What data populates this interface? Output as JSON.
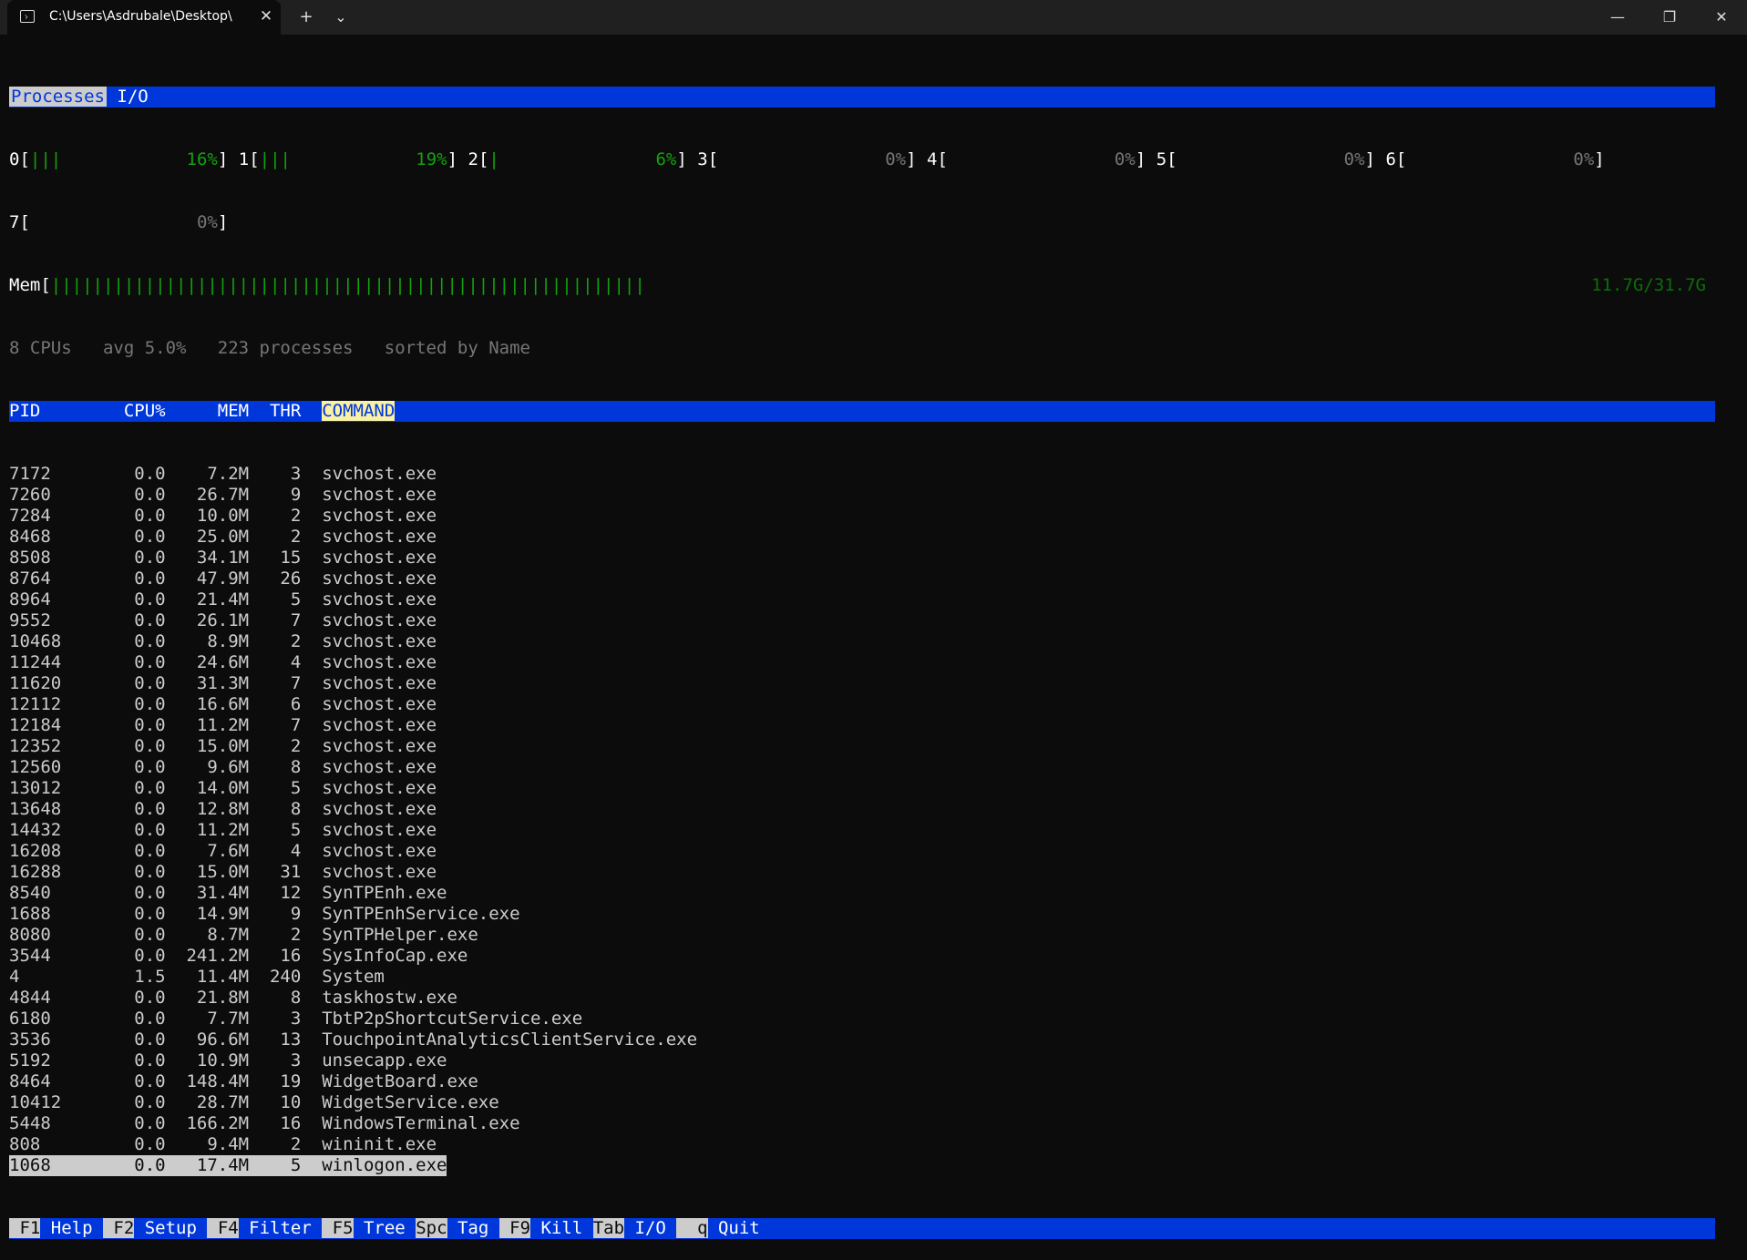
{
  "window": {
    "tab_title": "C:\\Users\\Asdrubale\\Desktop\\",
    "new_tab": "+",
    "dropdown": "⌄",
    "minimize": "—",
    "maximize": "❐",
    "close": "✕"
  },
  "tabs": [
    {
      "label": "Processes",
      "active": true
    },
    {
      "label": "I/O",
      "active": false
    }
  ],
  "cpus": [
    {
      "id": "0",
      "bars": "|||",
      "pct": "16%"
    },
    {
      "id": "1",
      "bars": "|||",
      "pct": "19%"
    },
    {
      "id": "2",
      "bars": "|",
      "pct": "6%"
    },
    {
      "id": "3",
      "bars": "",
      "pct": "0%"
    },
    {
      "id": "4",
      "bars": "",
      "pct": "0%"
    },
    {
      "id": "5",
      "bars": "",
      "pct": "0%"
    },
    {
      "id": "6",
      "bars": "",
      "pct": "0%"
    },
    {
      "id": "7",
      "bars": "",
      "pct": "0%"
    }
  ],
  "mem": {
    "label": "Mem",
    "bars": "|||||||||||||||||||||||||||||||||||||||||||||||||||||||||",
    "value": "11.7G/31.7G"
  },
  "summary": "8 CPUs   avg 5.0%   223 processes   sorted by Name",
  "columns": [
    "PID",
    "CPU%",
    "MEM",
    "THR",
    "COMMAND"
  ],
  "processes": [
    [
      "7172",
      "0.0",
      "7.2M",
      "3",
      "svchost.exe"
    ],
    [
      "7260",
      "0.0",
      "26.7M",
      "9",
      "svchost.exe"
    ],
    [
      "7284",
      "0.0",
      "10.0M",
      "2",
      "svchost.exe"
    ],
    [
      "8468",
      "0.0",
      "25.0M",
      "2",
      "svchost.exe"
    ],
    [
      "8508",
      "0.0",
      "34.1M",
      "15",
      "svchost.exe"
    ],
    [
      "8764",
      "0.0",
      "47.9M",
      "26",
      "svchost.exe"
    ],
    [
      "8964",
      "0.0",
      "21.4M",
      "5",
      "svchost.exe"
    ],
    [
      "9552",
      "0.0",
      "26.1M",
      "7",
      "svchost.exe"
    ],
    [
      "10468",
      "0.0",
      "8.9M",
      "2",
      "svchost.exe"
    ],
    [
      "11244",
      "0.0",
      "24.6M",
      "4",
      "svchost.exe"
    ],
    [
      "11620",
      "0.0",
      "31.3M",
      "7",
      "svchost.exe"
    ],
    [
      "12112",
      "0.0",
      "16.6M",
      "6",
      "svchost.exe"
    ],
    [
      "12184",
      "0.0",
      "11.2M",
      "7",
      "svchost.exe"
    ],
    [
      "12352",
      "0.0",
      "15.0M",
      "2",
      "svchost.exe"
    ],
    [
      "12560",
      "0.0",
      "9.6M",
      "8",
      "svchost.exe"
    ],
    [
      "13012",
      "0.0",
      "14.0M",
      "5",
      "svchost.exe"
    ],
    [
      "13648",
      "0.0",
      "12.8M",
      "8",
      "svchost.exe"
    ],
    [
      "14432",
      "0.0",
      "11.2M",
      "5",
      "svchost.exe"
    ],
    [
      "16208",
      "0.0",
      "7.6M",
      "4",
      "svchost.exe"
    ],
    [
      "16288",
      "0.0",
      "15.0M",
      "31",
      "svchost.exe"
    ],
    [
      "8540",
      "0.0",
      "31.4M",
      "12",
      "SynTPEnh.exe"
    ],
    [
      "1688",
      "0.0",
      "14.9M",
      "9",
      "SynTPEnhService.exe"
    ],
    [
      "8080",
      "0.0",
      "8.7M",
      "2",
      "SynTPHelper.exe"
    ],
    [
      "3544",
      "0.0",
      "241.2M",
      "16",
      "SysInfoCap.exe"
    ],
    [
      "4",
      "1.5",
      "11.4M",
      "240",
      "System"
    ],
    [
      "4844",
      "0.0",
      "21.8M",
      "8",
      "taskhostw.exe"
    ],
    [
      "6180",
      "0.0",
      "7.7M",
      "3",
      "TbtP2pShortcutService.exe"
    ],
    [
      "3536",
      "0.0",
      "96.6M",
      "13",
      "TouchpointAnalyticsClientService.exe"
    ],
    [
      "5192",
      "0.0",
      "10.9M",
      "3",
      "unsecapp.exe"
    ],
    [
      "8464",
      "0.0",
      "148.4M",
      "19",
      "WidgetBoard.exe"
    ],
    [
      "10412",
      "0.0",
      "28.7M",
      "10",
      "WidgetService.exe"
    ],
    [
      "5448",
      "0.0",
      "166.2M",
      "16",
      "WindowsTerminal.exe"
    ],
    [
      "808",
      "0.0",
      "9.4M",
      "2",
      "wininit.exe"
    ],
    [
      "1068",
      "0.0",
      "17.4M",
      "5",
      "winlogon.exe"
    ]
  ],
  "selected_index": 33,
  "footer": [
    {
      "key": "F1",
      "label": "Help"
    },
    {
      "key": "F2",
      "label": "Setup"
    },
    {
      "key": "F4",
      "label": "Filter"
    },
    {
      "key": "F5",
      "label": "Tree"
    },
    {
      "key": "Spc",
      "label": "Tag"
    },
    {
      "key": "F9",
      "label": "Kill"
    },
    {
      "key": "Tab",
      "label": "I/O"
    },
    {
      "key": "q",
      "label": "Quit"
    }
  ],
  "colors": {
    "blue": "#0037da",
    "green": "#13a10e",
    "dark_green": "#0b6e08",
    "highlight": "#cccccc"
  }
}
